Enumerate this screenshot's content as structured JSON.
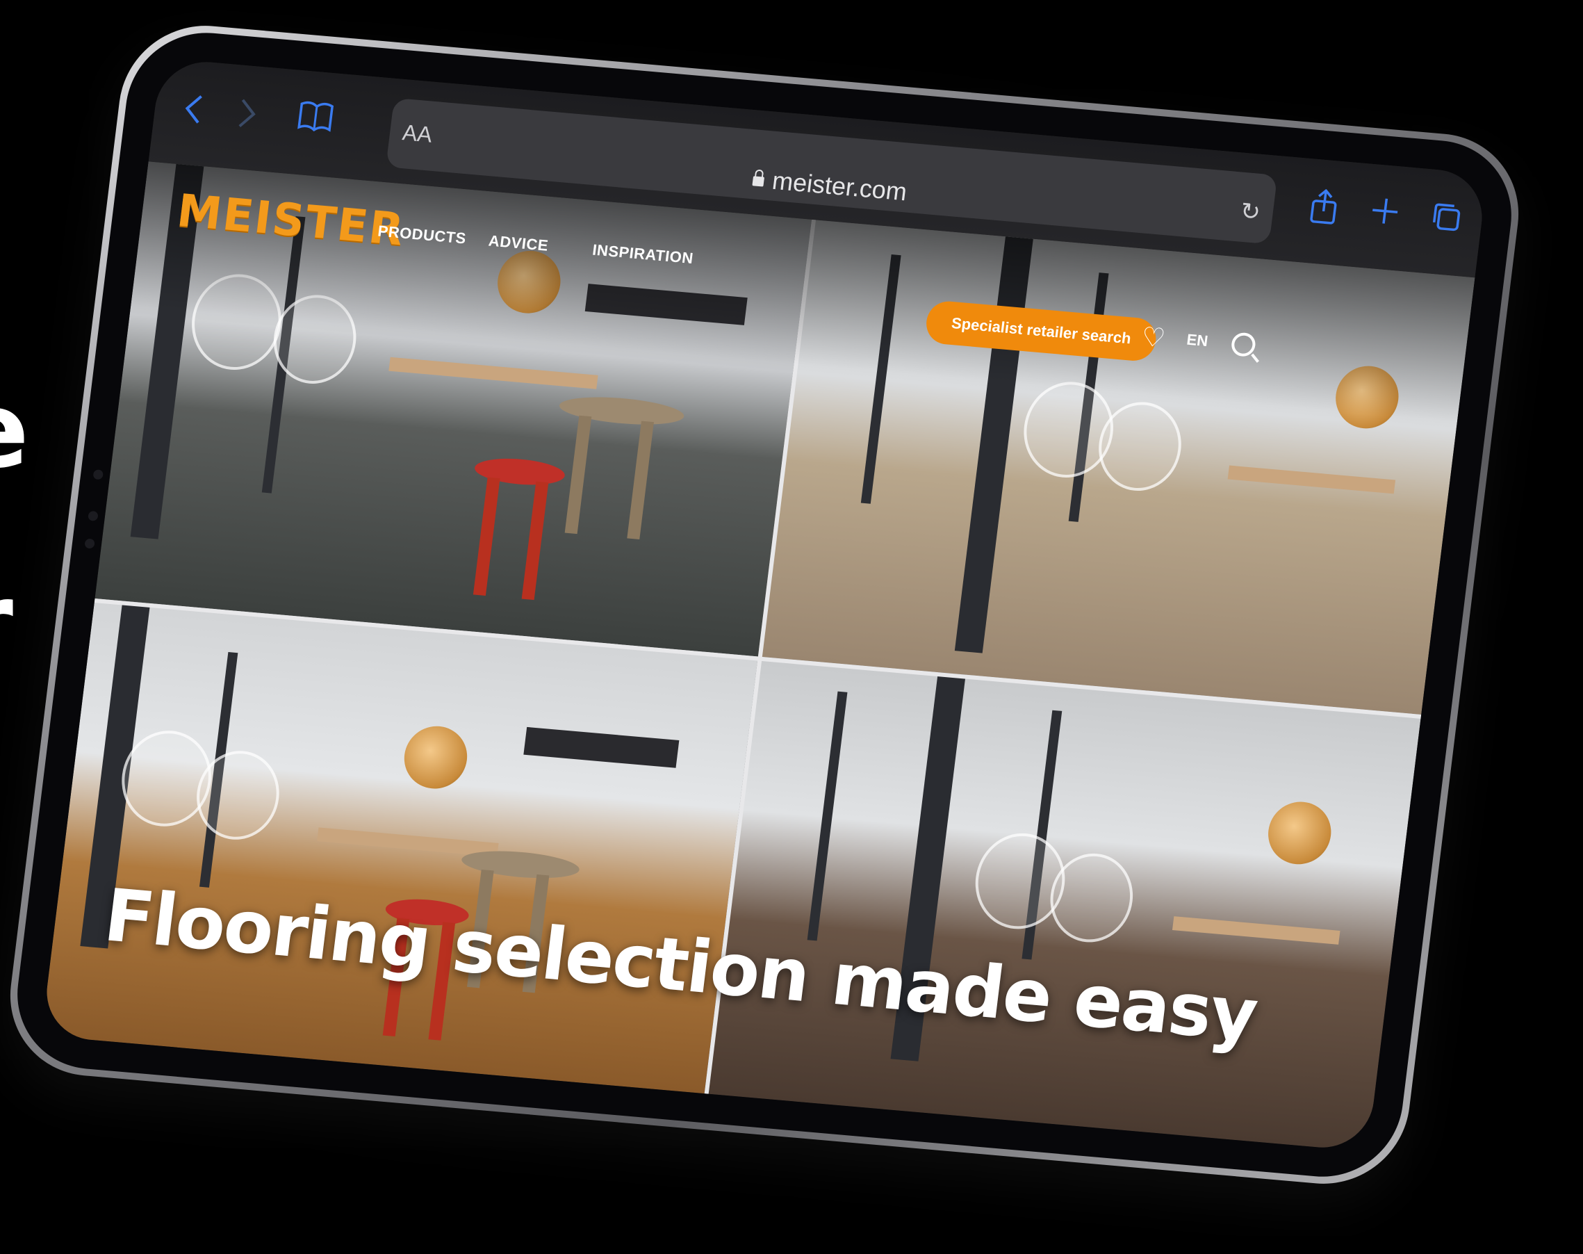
{
  "side_text": {
    "glyph_1": "e",
    "glyph_2": "r"
  },
  "browser": {
    "back_icon": "chevron-left-icon",
    "forward_icon": "chevron-right-icon",
    "bookmarks_icon": "book-icon",
    "reader_label": "AA",
    "url": "meister.com",
    "reload_icon": "reload-icon",
    "share_icon": "share-icon",
    "new_tab_icon": "plus-icon",
    "tabs_icon": "tabs-icon",
    "accent_color": "#3a7bf0"
  },
  "site": {
    "logo": "MEISTER",
    "nav": {
      "products": "PRODUCTS",
      "advice": "ADVICE",
      "inspiration": "INSPIRATION"
    },
    "retailer_button": "Specialist retailer search",
    "language": "EN",
    "brand_color": "#f08a0c",
    "hero_title": "Flooring selection made easy"
  }
}
